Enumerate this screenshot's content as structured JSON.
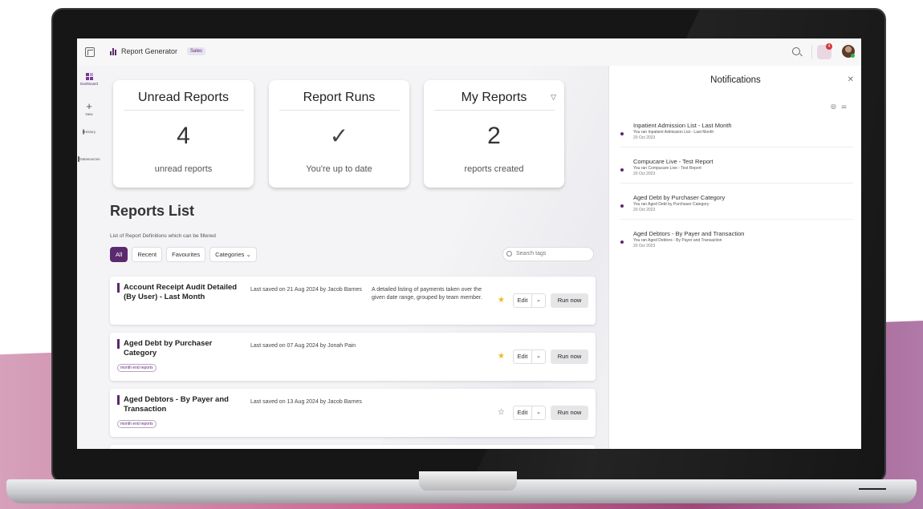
{
  "header": {
    "app_title": "Report Generator",
    "context_badge": "Sales",
    "notification_count": "4"
  },
  "rail": {
    "items": [
      {
        "label": "Dashboard",
        "icon": "dashboard-icon",
        "active": true
      },
      {
        "label": "New",
        "icon": "plus-icon"
      },
      {
        "label": "History",
        "icon": "history-icon"
      },
      {
        "label": "Datasources",
        "icon": "database-icon"
      }
    ]
  },
  "cards": [
    {
      "title": "Unread Reports",
      "value": "4",
      "caption": "unread reports"
    },
    {
      "title": "Report Runs",
      "value": "✓",
      "caption": "You're up to date"
    },
    {
      "title": "My Reports",
      "value": "2",
      "caption": "reports created"
    }
  ],
  "reports": {
    "title": "Reports List",
    "description": "List of Report Definitions which can be filtered",
    "filters": [
      "All",
      "Recent",
      "Favourites",
      "Categories ⌄"
    ],
    "search_placeholder": "Search tags",
    "rows": [
      {
        "name": "Account Receipt Audit Detailed (By User) - Last Month",
        "saved": "Last saved on 21 Aug 2024 by Jacob Barnes",
        "description": "A detailed listing of payments taken over the given date range, grouped by team member.",
        "tag": "",
        "favourite": true
      },
      {
        "name": "Aged Debt by Purchaser Category",
        "saved": "Last saved on 07 Aug 2024 by Jonah Pain",
        "description": "",
        "tag": "month end reports",
        "favourite": true
      },
      {
        "name": "Aged Debtors - By Payer and Transaction",
        "saved": "Last saved on 13 Aug 2024 by Jacob Barnes",
        "description": "",
        "tag": "month end reports",
        "favourite": false
      }
    ],
    "edit_label": "Edit",
    "run_label": "Run now"
  },
  "notifications": {
    "title": "Notifications",
    "items": [
      {
        "title": "Inpatient Admission List - Last Month",
        "detail": "You ran Inpatient Admission List - Last Month",
        "date": "20 Oct 2023"
      },
      {
        "title": "Compucare Live - Test Report",
        "detail": "You ran Compucare Live - Test Report",
        "date": "20 Oct 2023"
      },
      {
        "title": "Aged Debt by Purchaser Category",
        "detail": "You ran Aged Debt by Purchaser Category",
        "date": "20 Oct 2023"
      },
      {
        "title": "Aged Debtors - By Payer and Transaction",
        "detail": "You ran Aged Debtors - By Payer and Transaction",
        "date": "20 Oct 2023"
      }
    ]
  },
  "colors": {
    "accent": "#5b2a6e",
    "favourite": "#f0b81e"
  }
}
